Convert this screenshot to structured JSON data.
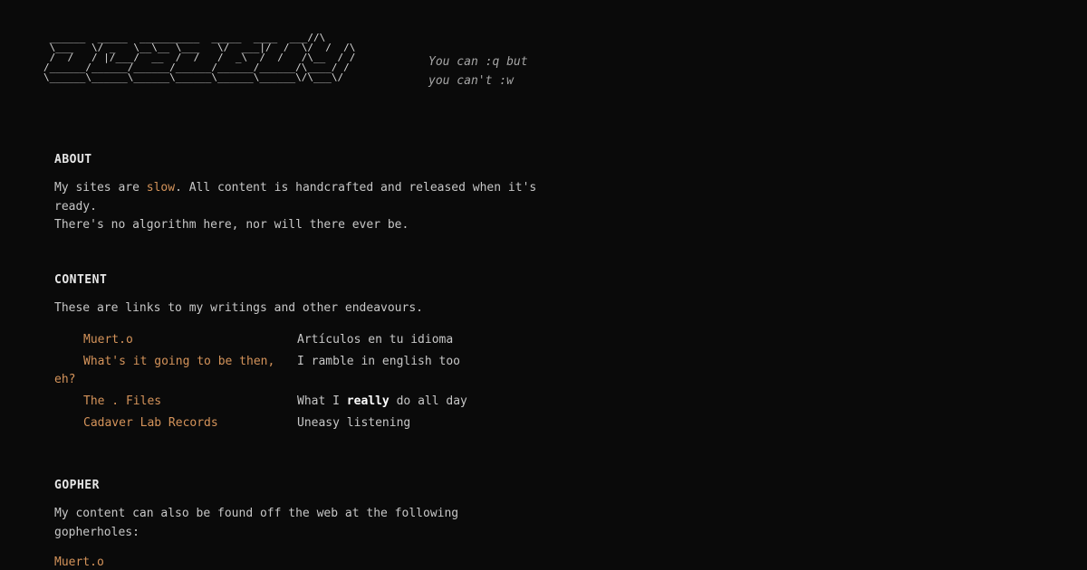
{
  "header": {
    "logo_ascii": " ______  _____  __________  _____  ____  ___//\\\n \\___   \\/ _   \\__\\__ \\___   \\/  ___|/  /  \\/  /  /\\\n /  /   / |/___/  __  /  /   /  _\\  /  /   /\\__  / /\n/______/______/______/______/______/______/\\____/ /\n\\______\\______\\______\\______\\______\\______\\/\\___\\/",
    "tagline_line1": "You can :q but",
    "tagline_line2": "you can't :w"
  },
  "about": {
    "title": "ABOUT",
    "text_before_link": "My sites are ",
    "link_label": "slow",
    "text_after_link": ". All content is handcrafted and released when it's ready.",
    "line2": "There's no algorithm here, nor will there ever be."
  },
  "content": {
    "title": "CONTENT",
    "intro": "These are links to my writings and other endeavours.",
    "links": [
      {
        "name": "Muert.o",
        "desc": "Artículos en tu idioma"
      },
      {
        "name_line1": "What's it going to be then,",
        "name_line2": "eh?",
        "desc": "I ramble in english too"
      },
      {
        "name": "The . Files",
        "desc_before": "What I ",
        "desc_strong": "really",
        "desc_after": " do all day"
      },
      {
        "name": "Cadaver Lab Records",
        "desc": "Uneasy listening"
      }
    ]
  },
  "gopher": {
    "title": "GOPHER",
    "text": "My content can also be found off the web at the following gopherholes:",
    "links": [
      {
        "name": "Muert.o"
      }
    ]
  },
  "colors": {
    "background": "#0a0a0a",
    "text": "#c7c7c7",
    "link": "#d4935a",
    "heading": "#e6e6e6"
  }
}
